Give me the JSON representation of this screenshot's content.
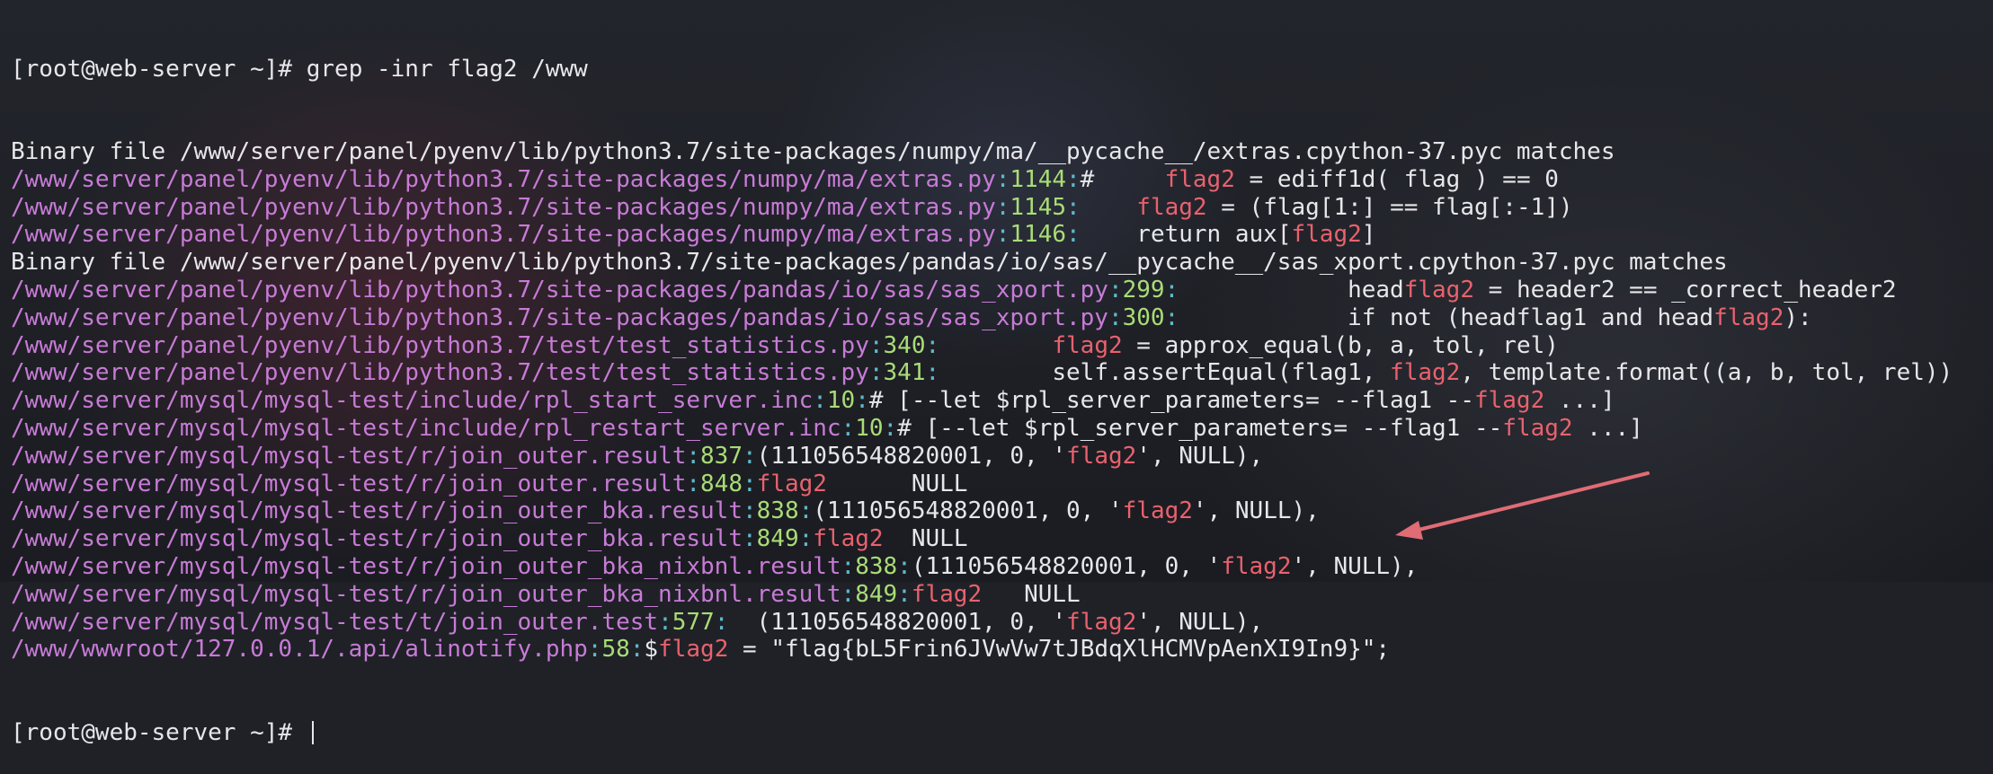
{
  "colors": {
    "background": "#1f2127",
    "text": "#e7e7ea",
    "path": "#c77bd6",
    "separator": "#5fb9c9",
    "line_number": "#a9dc76",
    "match": "#e8626e",
    "arrow": "#e06c75"
  },
  "prompt": {
    "text": "[root@web-server ~]# ",
    "command": "grep -inr flag2 /www"
  },
  "lines": [
    {
      "kind": "binary",
      "text": "Binary file /www/server/panel/pyenv/lib/python3.7/site-packages/numpy/ma/__pycache__/extras.cpython-37.pyc matches"
    },
    {
      "kind": "match",
      "path": "/www/server/panel/pyenv/lib/python3.7/site-packages/numpy/ma/extras.py",
      "line": "1144",
      "parts": [
        {
          "t": "#     "
        },
        {
          "t": "flag2",
          "h": true
        },
        {
          "t": " = ediff1d( flag ) == 0"
        }
      ]
    },
    {
      "kind": "match",
      "path": "/www/server/panel/pyenv/lib/python3.7/site-packages/numpy/ma/extras.py",
      "line": "1145",
      "parts": [
        {
          "t": "    "
        },
        {
          "t": "flag2",
          "h": true
        },
        {
          "t": " = (flag[1:] == flag[:-1])"
        }
      ]
    },
    {
      "kind": "match",
      "path": "/www/server/panel/pyenv/lib/python3.7/site-packages/numpy/ma/extras.py",
      "line": "1146",
      "parts": [
        {
          "t": "    return aux["
        },
        {
          "t": "flag2",
          "h": true
        },
        {
          "t": "]"
        }
      ]
    },
    {
      "kind": "binary",
      "text": "Binary file /www/server/panel/pyenv/lib/python3.7/site-packages/pandas/io/sas/__pycache__/sas_xport.cpython-37.pyc matches"
    },
    {
      "kind": "match",
      "path": "/www/server/panel/pyenv/lib/python3.7/site-packages/pandas/io/sas/sas_xport.py",
      "line": "299",
      "parts": [
        {
          "t": "            head"
        },
        {
          "t": "flag2",
          "h": true
        },
        {
          "t": " = header2 == _correct_header2"
        }
      ]
    },
    {
      "kind": "match",
      "path": "/www/server/panel/pyenv/lib/python3.7/site-packages/pandas/io/sas/sas_xport.py",
      "line": "300",
      "parts": [
        {
          "t": "            if not (headflag1 and head"
        },
        {
          "t": "flag2",
          "h": true
        },
        {
          "t": "):"
        }
      ]
    },
    {
      "kind": "match",
      "path": "/www/server/panel/pyenv/lib/python3.7/test/test_statistics.py",
      "line": "340",
      "parts": [
        {
          "t": "        "
        },
        {
          "t": "flag2",
          "h": true
        },
        {
          "t": " = approx_equal(b, a, tol, rel)"
        }
      ]
    },
    {
      "kind": "match",
      "path": "/www/server/panel/pyenv/lib/python3.7/test/test_statistics.py",
      "line": "341",
      "parts": [
        {
          "t": "        self.assertEqual(flag1, "
        },
        {
          "t": "flag2",
          "h": true
        },
        {
          "t": ", template.format((a, b, tol, rel))"
        }
      ]
    },
    {
      "kind": "match",
      "path": "/www/server/mysql/mysql-test/include/rpl_start_server.inc",
      "line": "10",
      "parts": [
        {
          "t": "# [--let $rpl_server_parameters= --flag1 --"
        },
        {
          "t": "flag2",
          "h": true
        },
        {
          "t": " ...]"
        }
      ]
    },
    {
      "kind": "match",
      "path": "/www/server/mysql/mysql-test/include/rpl_restart_server.inc",
      "line": "10",
      "parts": [
        {
          "t": "# [--let $rpl_server_parameters= --flag1 --"
        },
        {
          "t": "flag2",
          "h": true
        },
        {
          "t": " ...]"
        }
      ]
    },
    {
      "kind": "match",
      "path": "/www/server/mysql/mysql-test/r/join_outer.result",
      "line": "837",
      "parts": [
        {
          "t": "(111056548820001, 0, '"
        },
        {
          "t": "flag2",
          "h": true
        },
        {
          "t": "', NULL),"
        }
      ]
    },
    {
      "kind": "match",
      "path": "/www/server/mysql/mysql-test/r/join_outer.result",
      "line": "848",
      "parts": [
        {
          "t": "flag2",
          "h": true
        },
        {
          "t": "      NULL"
        }
      ]
    },
    {
      "kind": "match",
      "path": "/www/server/mysql/mysql-test/r/join_outer_bka.result",
      "line": "838",
      "parts": [
        {
          "t": "(111056548820001, 0, '"
        },
        {
          "t": "flag2",
          "h": true
        },
        {
          "t": "', NULL),"
        }
      ]
    },
    {
      "kind": "match",
      "path": "/www/server/mysql/mysql-test/r/join_outer_bka.result",
      "line": "849",
      "parts": [
        {
          "t": "flag2",
          "h": true
        },
        {
          "t": "  NULL"
        }
      ]
    },
    {
      "kind": "match",
      "path": "/www/server/mysql/mysql-test/r/join_outer_bka_nixbnl.result",
      "line": "838",
      "parts": [
        {
          "t": "(111056548820001, 0, '"
        },
        {
          "t": "flag2",
          "h": true
        },
        {
          "t": "', NULL),"
        }
      ]
    },
    {
      "kind": "match",
      "path": "/www/server/mysql/mysql-test/r/join_outer_bka_nixbnl.result",
      "line": "849",
      "parts": [
        {
          "t": "flag2",
          "h": true
        },
        {
          "t": "   NULL"
        }
      ]
    },
    {
      "kind": "match",
      "path": "/www/server/mysql/mysql-test/t/join_outer.test",
      "line": "577",
      "parts": [
        {
          "t": "  (111056548820001, 0, '"
        },
        {
          "t": "flag2",
          "h": true
        },
        {
          "t": "', NULL),"
        }
      ]
    },
    {
      "kind": "match",
      "path": "/www/wwwroot/127.0.0.1/.api/alinotify.php",
      "line": "58",
      "parts": [
        {
          "t": "$"
        },
        {
          "t": "flag2",
          "h": true
        },
        {
          "t": " = \"flag{bL5Frin6JVwVw7tJBdqXlHCMVpAenXI9In9}\";"
        }
      ]
    }
  ],
  "final_prompt": "[root@web-server ~]# "
}
